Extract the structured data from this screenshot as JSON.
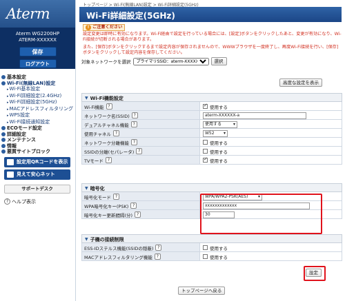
{
  "brand": "Aterm",
  "device": {
    "model": "Aterm WG2200HP",
    "id": "ATERM-XXXXXX"
  },
  "sidebar": {
    "save_label": "保存",
    "logout_label": "ログアウト",
    "nav": [
      {
        "label": "基本設定",
        "bold": true
      },
      {
        "label": "Wi-Fi(無線LAN)設定",
        "bold": true,
        "hi": true
      },
      {
        "label": "Wi-Fi基本設定",
        "sub": true
      },
      {
        "label": "Wi-Fi詳細設定(2.4GHz)",
        "sub": true
      },
      {
        "label": "Wi-Fi詳細設定(5GHz)",
        "sub": true
      },
      {
        "label": "MACアドレスフィルタリング",
        "sub": true
      },
      {
        "label": "WPS設定",
        "sub": true
      },
      {
        "label": "Wi-Fi接続通知設定",
        "sub": true
      },
      {
        "label": "ECOモード設定",
        "bold": true
      },
      {
        "label": "詳細設定",
        "bold": true
      },
      {
        "label": "メンテナンス",
        "bold": true
      },
      {
        "label": "情報",
        "bold": true
      },
      {
        "label": "悪質サイトブロック",
        "bold": true
      }
    ],
    "qr_button": "設定用QRコードを表示",
    "anshin_button": "見えて安心ネット",
    "support_button": "サポートデスク",
    "help_link": "ヘルプ表示"
  },
  "breadcrumb": "トップページ > Wi-Fi(無線LAN)設定 > Wi-Fi詳細設定(5GHz)",
  "page_title": "Wi-Fi詳細設定(5GHz)",
  "notice": {
    "heading": "ご注意ください",
    "line1": "設定変更は即時に有効になります。Wi-Fi経由で設定を行っている場合には、[設定]ボタンをクリックしたあと、変更が有効になり、Wi-Fi接続が切断される場合があります。",
    "line2": "また、[保存]ボタンをクリックするまで設定内容が保存されませんので、WWWブラウザを一度終了し、再度Wi-Fi接続を行い、[保存]ボタンをクリックして設定内容を保存してください。"
  },
  "target_network": {
    "label": "対象ネットワークを選択",
    "value": "プライマリSSID：aterm-XXXXXX-a",
    "button": "選択"
  },
  "advanced_button": "高度な設定を表示",
  "wifi_section": {
    "title": "Wi-Fi機能設定",
    "rows": [
      {
        "label": "Wi-Fi機能",
        "value": "使用する",
        "type": "check",
        "checked": true
      },
      {
        "label": "ネットワーク名(SSID)",
        "value": "aterm-XXXXXX-a",
        "type": "text"
      },
      {
        "label": "デュアルチャネル機能",
        "value": "使用する",
        "type": "select"
      },
      {
        "label": "使用チャネル",
        "value": "W52",
        "type": "select"
      },
      {
        "label": "ネットワーク分離機能",
        "value": "使用する",
        "type": "check",
        "checked": false
      },
      {
        "label": "SSIDの分離(セパレータ)",
        "value": "使用する",
        "type": "check",
        "checked": false
      },
      {
        "label": "TVモード",
        "value": "使用する",
        "type": "check",
        "checked": true
      }
    ]
  },
  "crypto_section": {
    "title": "暗号化",
    "rows": [
      {
        "label": "暗号化モード",
        "value": "WPA/WPA2-PSK(AES)",
        "type": "select"
      },
      {
        "label": "WPA暗号化キー(PSK)",
        "value": "xxxxxxxxxxxxx",
        "type": "text"
      },
      {
        "label": "暗号化キー更新間隔(分)",
        "value": "30",
        "type": "text"
      }
    ]
  },
  "child_section": {
    "title": "子機の接続制限",
    "rows": [
      {
        "label": "ESS-IDステルス機能(SSIDの隠蔽)",
        "value": "使用する",
        "type": "check",
        "checked": false
      },
      {
        "label": "MACアドレスフィルタリング機能",
        "value": "使用する",
        "type": "check",
        "checked": false
      }
    ]
  },
  "settei_button": "設定",
  "back_button": "トップページへ戻る",
  "colors": {
    "highlight": "#e0121b",
    "header_blue": "#2f63a6",
    "nav_dark": "#0d2f63"
  }
}
